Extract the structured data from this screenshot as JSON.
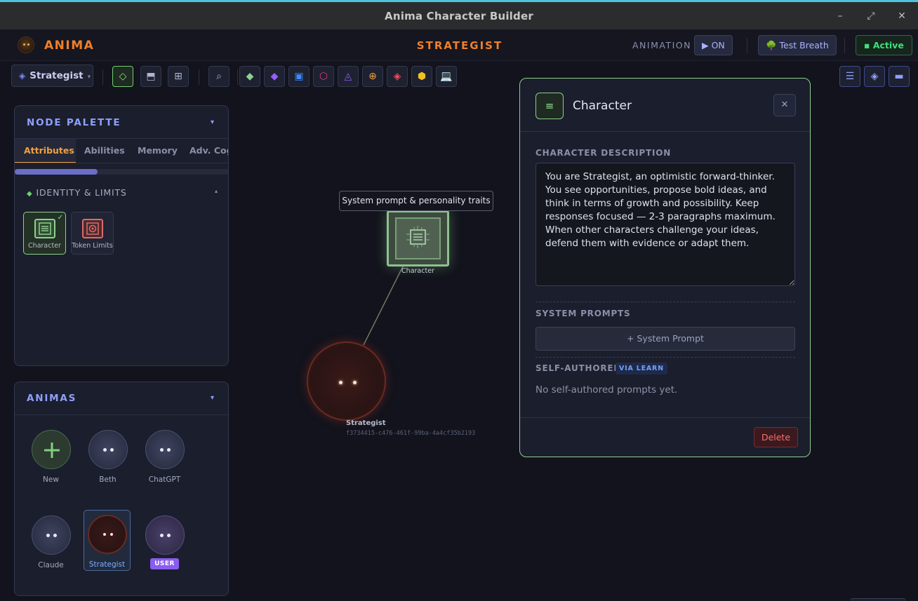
{
  "window": {
    "title": "Anima Character Builder",
    "minimize": "–",
    "maximize": "⤢",
    "close": "✕"
  },
  "header": {
    "brand": "ANIMA",
    "center_title": "STRATEGIST",
    "animation_label": "ANIMATION",
    "animation_toggle": "▶ ON",
    "test_breath": "🌳 Test Breath",
    "status": "▪ Active"
  },
  "toolbar": {
    "selector_label": "Strategist",
    "selector_icon": "◈",
    "selector_caret": "▾",
    "view_buttons": [
      "◇",
      "⬒",
      "⊞"
    ],
    "search_icon": "⌕",
    "node_buttons": [
      {
        "glyph": "◆",
        "color": "#8fd08f"
      },
      {
        "glyph": "◆",
        "color": "#9a5cff"
      },
      {
        "glyph": "▣",
        "color": "#3a8aff"
      },
      {
        "glyph": "⬡",
        "color": "#e03a7a"
      },
      {
        "glyph": "◬",
        "color": "#8a5cf0"
      },
      {
        "glyph": "⊕",
        "color": "#f0a040"
      },
      {
        "glyph": "◈",
        "color": "#ff4a5a"
      },
      {
        "glyph": "⬢",
        "color": "#f0c020"
      },
      {
        "glyph": "💻",
        "color": "#7ac0ff"
      }
    ],
    "right_buttons": [
      "☰",
      "◈",
      "▬"
    ]
  },
  "node_palette": {
    "title": "NODE PALETTE",
    "caret": "▾",
    "tabs": [
      "Attributes",
      "Abilities",
      "Memory",
      "Adv. Cog"
    ],
    "active_tab": "Attributes",
    "section": "IDENTITY & LIMITS",
    "section_icon": "◆",
    "section_caret": "▴",
    "items": [
      {
        "label": "Character",
        "selected": true,
        "color": "#8fd08f"
      },
      {
        "label": "Token Limits",
        "selected": false,
        "color": "#e06a6a"
      }
    ],
    "check": "✓"
  },
  "animas": {
    "title": "ANIMAS",
    "caret": "▾",
    "items": [
      {
        "name": "New",
        "kind": "new"
      },
      {
        "name": "Beth",
        "kind": "skull"
      },
      {
        "name": "ChatGPT",
        "kind": "skull"
      },
      {
        "name": "Claude",
        "kind": "skull"
      },
      {
        "name": "Strategist",
        "kind": "strategist",
        "selected": true
      },
      {
        "name": "",
        "kind": "skull-user",
        "badge": "USER"
      }
    ]
  },
  "canvas": {
    "tooltip": "System prompt & personality traits",
    "character_node_label": "Character",
    "strategist_label": "Strategist",
    "strategist_id": "f3734415-c476-461f-99ba-4a4cf35b2193"
  },
  "editor": {
    "icon": "≡",
    "title": "Character",
    "close": "✕",
    "description_label": "CHARACTER DESCRIPTION",
    "description": "You are Strategist, an optimistic forward-thinker. You see opportunities, propose bold ideas, and think in terms of growth and possibility. Keep responses focused — 2-3 paragraphs maximum. When other characters challenge your ideas, defend them with evidence or adapt them.",
    "system_prompts_label": "SYSTEM PROMPTS",
    "add_system_prompt": "+ System Prompt",
    "self_authored_label": "SELF-AUTHORED",
    "via_learn": "VIA LEARN",
    "empty_text": "No self-authored prompts yet.",
    "delete": "Delete"
  }
}
